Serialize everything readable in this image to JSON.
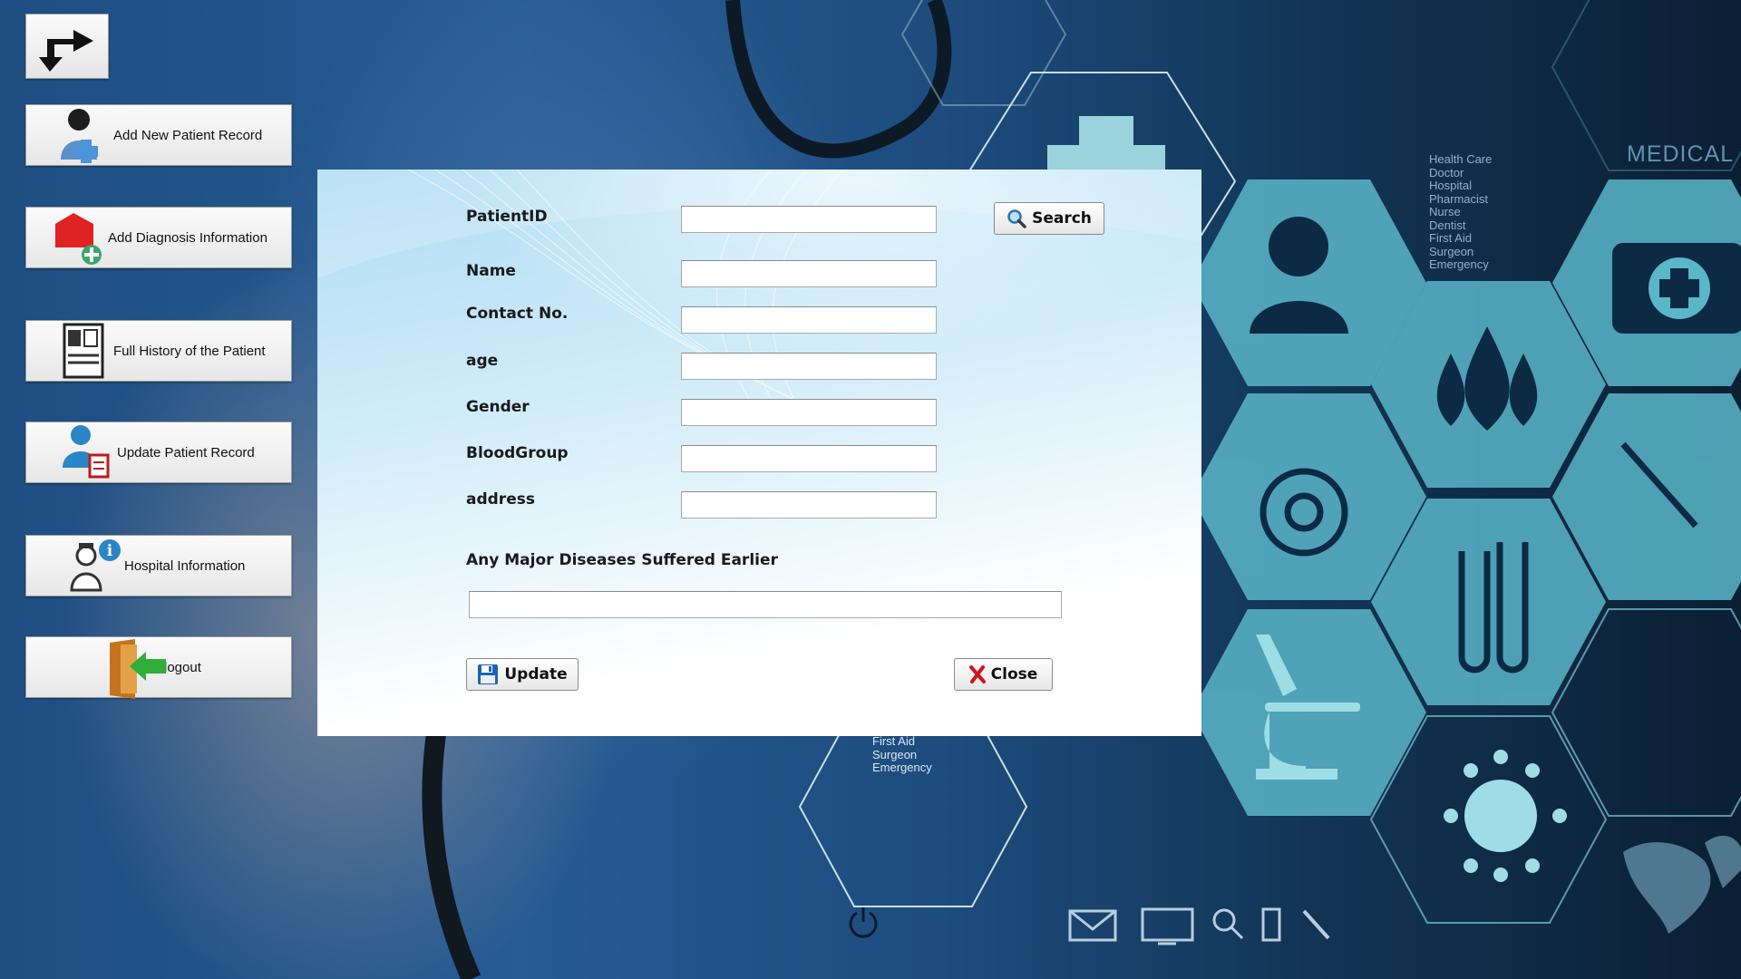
{
  "background": {
    "list_text": [
      "Health Care",
      "Doctor",
      "Hospital",
      "Pharmacist",
      "Nurse",
      "Dentist",
      "First Aid",
      "Surgeon",
      "Emergency"
    ],
    "lower_text": [
      "First Aid",
      "Surgeon",
      "Emergency"
    ],
    "medical_label": "MEDICAL",
    "icons": [
      "power-icon",
      "mail-icon",
      "monitor-icon",
      "search-icon",
      "phone-icon",
      "tool-icon"
    ]
  },
  "sidebar": {
    "back_icon": "turn-arrow-icon",
    "items": [
      {
        "label": "Add New Patient Record",
        "icon": "add-patient-icon"
      },
      {
        "label": "Add Diagnosis Information",
        "icon": "diagnosis-icon"
      },
      {
        "label": "Full History of the Patient",
        "icon": "history-icon"
      },
      {
        "label": "Update Patient Record",
        "icon": "update-patient-icon"
      },
      {
        "label": "Hospital Information",
        "icon": "hospital-info-icon"
      },
      {
        "label": "logout",
        "icon": "logout-door-icon"
      }
    ]
  },
  "form": {
    "labels": {
      "patient_id": "PatientID",
      "name": "Name",
      "contact": "Contact No.",
      "age": "age",
      "gender": "Gender",
      "blood_group": "BloodGroup",
      "address": "address",
      "diseases": "Any Major Diseases Suffered Earlier"
    },
    "values": {
      "patient_id": "",
      "name": "",
      "contact": "",
      "age": "",
      "gender": "",
      "blood_group": "",
      "address": "",
      "diseases": ""
    },
    "buttons": {
      "search": "Search",
      "update": "Update",
      "close": "Close"
    }
  },
  "colors": {
    "dialog_top": "#aedcf3",
    "hex_cyan": "#6cc5d3",
    "close_red": "#d0161b"
  }
}
